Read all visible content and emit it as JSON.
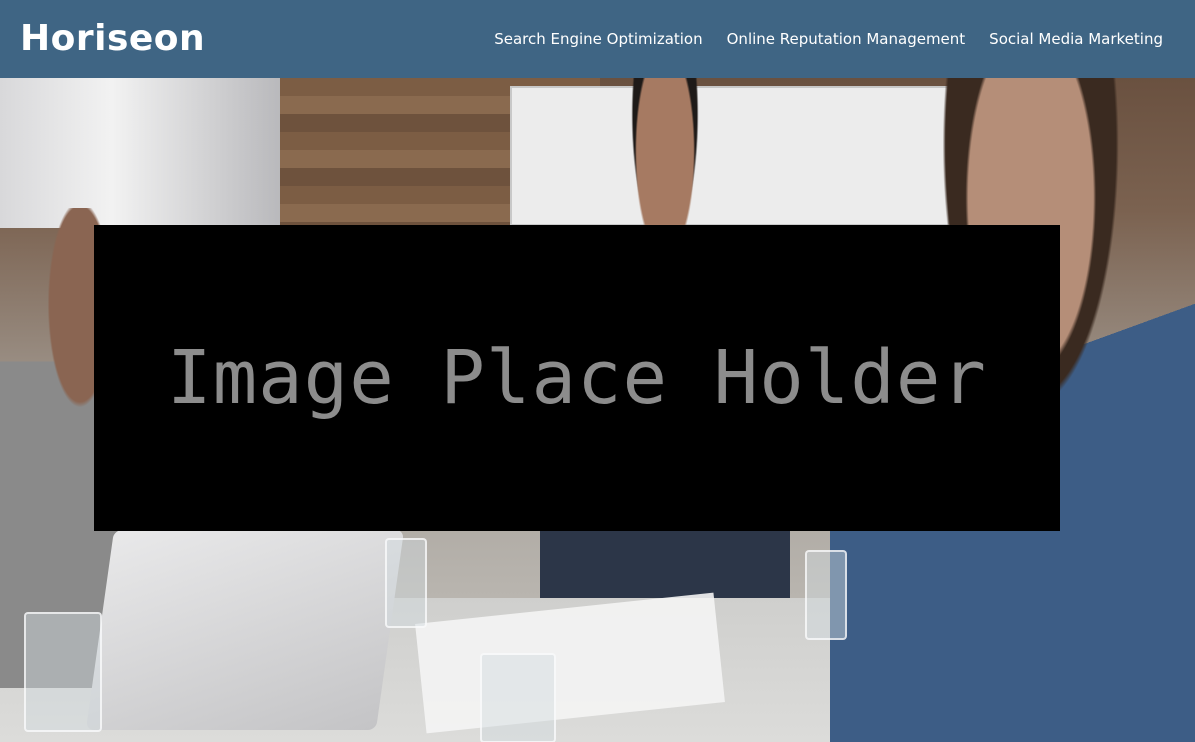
{
  "header": {
    "logo": "Horiseon",
    "nav": [
      {
        "label": "Search Engine Optimization"
      },
      {
        "label": "Online Reputation Management"
      },
      {
        "label": "Social Media Marketing"
      }
    ]
  },
  "hero": {
    "placeholder_text": "Image Place Holder"
  },
  "colors": {
    "header_bg": "#3f6584",
    "header_text": "#ffffff",
    "placeholder_bg": "#000000",
    "placeholder_text": "#8c8c8c"
  }
}
